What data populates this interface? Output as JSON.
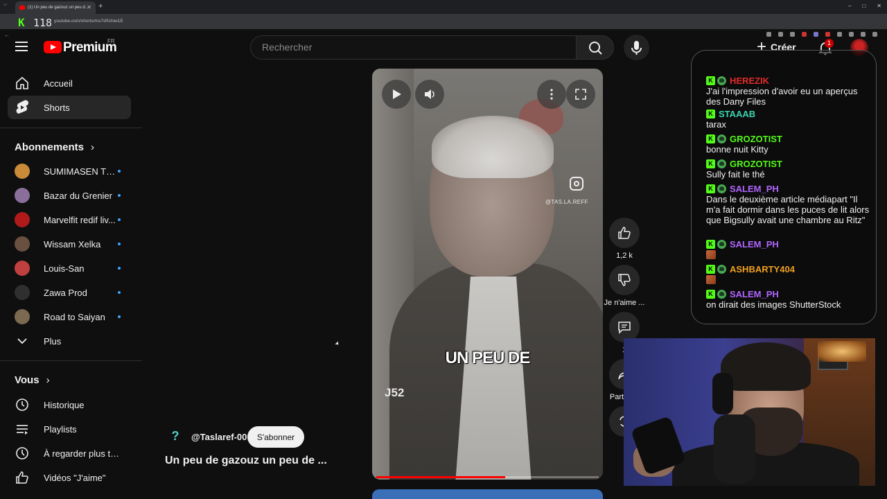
{
  "browser": {
    "tab_title": "(1) Un peu de gazouz un peu d...",
    "url": "youtube.com/shorts/ms7sRchiw1E",
    "overlay_logo_letter": "K",
    "overlay_logo_number": "118"
  },
  "header": {
    "logo_text": "Premium",
    "logo_region": "FR",
    "search_placeholder": "Rechercher",
    "create_label": "Créer",
    "notification_count": "1"
  },
  "sidebar": {
    "main_items": [
      {
        "label": "Accueil",
        "icon": "home-icon"
      },
      {
        "label": "Shorts",
        "icon": "shorts-icon",
        "active": true
      }
    ],
    "subscriptions_heading": "Abonnements",
    "channels": [
      {
        "label": "SUMIMASEN TU...",
        "color": "#c98a3a"
      },
      {
        "label": "Bazar du Grenier",
        "color": "#8a6f9a"
      },
      {
        "label": "Marvelfit redif liv...",
        "color": "#b01a1a"
      },
      {
        "label": "Wissam Xelka",
        "color": "#6a5040"
      },
      {
        "label": "Louis-San",
        "color": "#c04040"
      },
      {
        "label": "Zawa Prod",
        "color": "#2f2f2f"
      },
      {
        "label": "Road to Saiyan",
        "color": "#7a6a50"
      }
    ],
    "more_label": "Plus",
    "you_heading": "Vous",
    "you_items": [
      {
        "label": "Historique",
        "icon": "history-icon"
      },
      {
        "label": "Playlists",
        "icon": "playlists-icon"
      },
      {
        "label": "À regarder plus tard",
        "icon": "watch-later-icon"
      },
      {
        "label": "Vidéos \"J'aime\"",
        "icon": "liked-videos-icon"
      }
    ]
  },
  "video": {
    "caption": "UN PEU DE",
    "watermark_handle": "@TAS.LA.REFF",
    "corner_tag": "J52",
    "progress": 0.58,
    "channel_handle": "@Taslaref-00",
    "subscribe_label": "S'abonner",
    "title": "Un peu de gazouz un peu de ..."
  },
  "actions": {
    "likes": "1,2 k",
    "dislike_label": "Je n'aime ...",
    "comments": "1",
    "share_label": "Partager"
  },
  "chat": {
    "messages": [
      {
        "user": "HEREZIK",
        "color": "#e02a2a",
        "text": "J'ai l'impression d'avoir eu un aperçus des Dany Files"
      },
      {
        "user": "STAAAB",
        "color": "#39d6b0",
        "text": "tarax"
      },
      {
        "user": "GROZOTIST",
        "color": "#53fc18",
        "text": "bonne nuit Kitty"
      },
      {
        "user": "GROZOTIST",
        "color": "#53fc18",
        "text": "Sully fait le thé"
      },
      {
        "user": "SALEM_PH",
        "color": "#b066ff",
        "text": "Dans le deuxième article médiapart \"Il m'a fait dormir dans les puces de lit alors que Bigsully avait une chambre au Ritz\""
      },
      {
        "user": "SALEM_PH",
        "color": "#b066ff",
        "text": ""
      },
      {
        "user": "ASHBARTY404",
        "color": "#f0a020",
        "text": ""
      },
      {
        "user": "SALEM_PH",
        "color": "#b066ff",
        "text": "on dirait des images ShutterStock"
      }
    ]
  }
}
